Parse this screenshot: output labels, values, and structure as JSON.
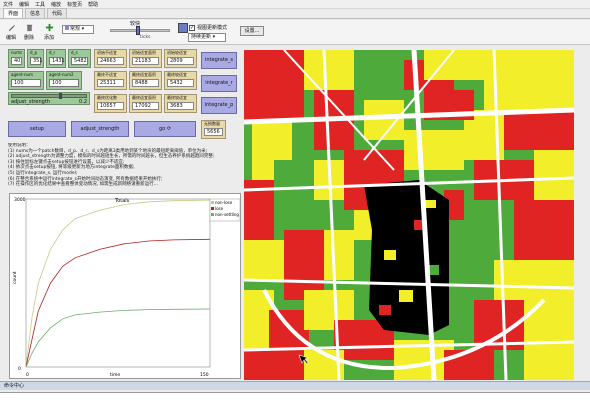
{
  "menu": [
    "文件",
    "编辑",
    "工具",
    "缩放",
    "标签页",
    "帮助"
  ],
  "tabs": [
    "界面",
    "信息",
    "代码"
  ],
  "toolbar": {
    "edit": "编辑",
    "delete": "删除",
    "add": "添加",
    "normal_speed": "常规",
    "speed_label": "较快",
    "ticks_label": "ticks",
    "view_updates_label": "视图更新模式",
    "update_mode": "持续更新",
    "settings": "设置..."
  },
  "inputs": [
    {
      "label": "nums",
      "value": "40"
    },
    {
      "label": "d_p",
      "value": "351"
    },
    {
      "label": "d_r",
      "value": "1431"
    },
    {
      "label": "d_s",
      "value": "5482"
    },
    {
      "label": "agent-num",
      "value": "100"
    },
    {
      "label": "agent-num2",
      "value": "100"
    }
  ],
  "slider": {
    "label": "adjust_strength",
    "value": "0.2"
  },
  "monitors": [
    {
      "label": "初始不适宜",
      "value": "24663"
    },
    {
      "label": "初始适宜面积",
      "value": "21183"
    },
    {
      "label": "初始较适宜",
      "value": "2809"
    },
    {
      "label": "最终不适宜",
      "value": "25311"
    },
    {
      "label": "最终适宜面积",
      "value": "8488"
    },
    {
      "label": "最终较适宜",
      "value": "5432"
    },
    {
      "label": "最终优化数",
      "value": "10657"
    },
    {
      "label": "最终适宜面积",
      "value": "17092"
    },
    {
      "label": "最终较适宜",
      "value": "3683"
    },
    {
      "label": "无损数量",
      "value": "5656"
    }
  ],
  "buttons": {
    "setup": "setup",
    "go": "go",
    "integrate_s": "integrate_s",
    "integrate_r": "integrate_r",
    "integrate_p": "integrate_p",
    "adjust_strength": "adjust_strength"
  },
  "info_text": "使用说明：\n(1) nums为一个patch数目，d_p、d_r、d_s为距离3类用地到某个地块的最短距离阈值，单位为米;\n(2) adjust_strength为调整力度，模拟的时间越短生长，所需的时间越长，但生态养护系统越趋同完整;\n(3) 按住鼠标左键点击setup按钮进行设置，以减少不适宜;\n(4) 依次点击setup按钮, 将等级更新为地方integrate面积数据;\n(5) 运行integrate_s, 运行model;\n(6) 在整合系统中运行integrate_s开始时间动态演变, 所有数据结果开始执行;\n(7) 在操作区的优化结果中查看整体变动情况, 如需生成新网络请重新运行...",
  "chart": {
    "title": "Totals",
    "xlabel": "time",
    "ylabel": "count",
    "y_max_label": "3000",
    "y_min_label": "0",
    "x_min_label": "0",
    "x_max_label": "150",
    "legend": [
      {
        "name": "non-lose",
        "color": "#c8c884"
      },
      {
        "name": "lose",
        "color": "#b02020"
      },
      {
        "name": "non-settling",
        "color": "#6cae6c"
      }
    ]
  },
  "chart_data": {
    "type": "line",
    "title": "Totals",
    "xlabel": "time",
    "ylabel": "count",
    "x": [
      0,
      5,
      10,
      20,
      30,
      40,
      60,
      80,
      100,
      120,
      150
    ],
    "ylim": [
      0,
      3000
    ],
    "series": [
      {
        "name": "non-lose",
        "values": [
          0,
          900,
          1500,
          2100,
          2450,
          2650,
          2800,
          2900,
          2950,
          2970,
          2980
        ]
      },
      {
        "name": "lose",
        "values": [
          0,
          500,
          1000,
          1500,
          1800,
          1950,
          2100,
          2200,
          2250,
          2270,
          2280
        ]
      },
      {
        "name": "non-settling",
        "values": [
          0,
          250,
          450,
          700,
          860,
          930,
          980,
          1010,
          1025,
          1030,
          1035
        ]
      }
    ]
  },
  "status_label": "命令中心",
  "colors": {
    "red": "#e02424",
    "yellow": "#f2ee2a",
    "green": "#4faa3c",
    "black": "#000000",
    "white": "#ffffff"
  }
}
